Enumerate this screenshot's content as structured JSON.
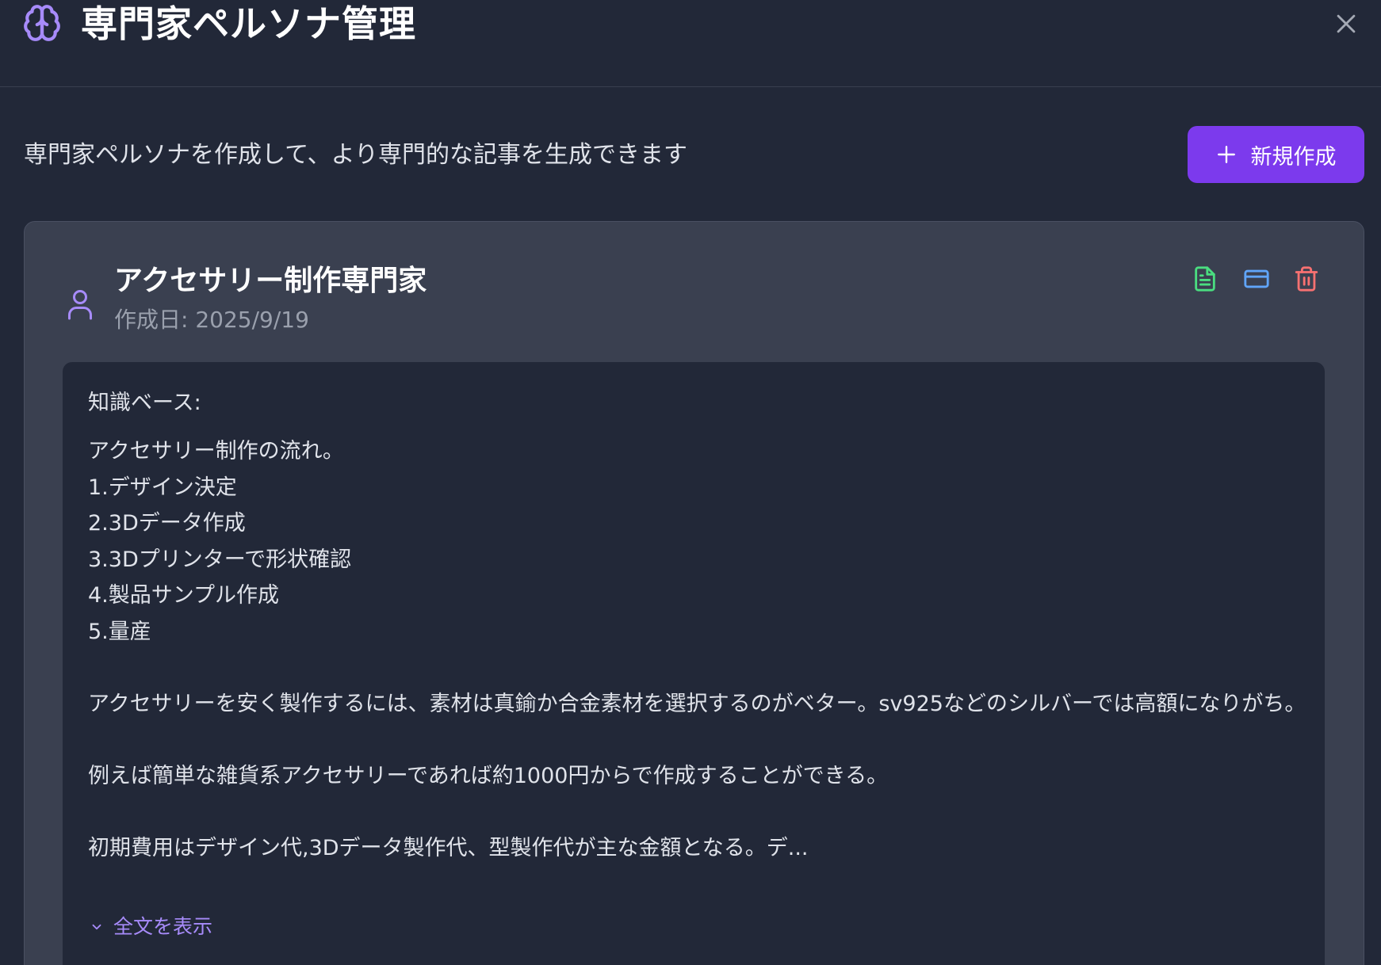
{
  "header": {
    "title": "専門家ペルソナ管理",
    "icon": "brain-icon",
    "close_icon": "close-icon"
  },
  "toolbar": {
    "description": "専門家ペルソナを作成して、より専門的な記事を生成できます",
    "new_button_label": "新規作成",
    "new_button_icon": "plus-icon"
  },
  "persona": {
    "name": "アクセサリー制作専門家",
    "created": "作成日: 2025/9/19",
    "icon": "person-icon",
    "actions": [
      "document-icon",
      "card-icon",
      "trash-icon"
    ],
    "knowledge_label": "知識ベース:",
    "knowledge_text": "アクセサリー制作の流れ。\n1.デザイン決定\n2.3Dデータ作成\n3.3Dプリンターで形状確認\n4.製品サンプル作成\n5.量産\n\nアクセサリーを安く製作するには、素材は真鍮か合金素材を選択するのがベター。sv925などのシルバーでは高額になりがち。\n\n例えば簡単な雑貨系アクセサリーであれば約1000円からで作成することができる。\n\n初期費用はデザイン代,3Dデータ製作代、型製作代が主な金額となる。デ...",
    "expand_label": "全文を表示"
  },
  "colors": {
    "background": "#222838",
    "card": "#3a4050",
    "accent": "#7c3aed",
    "link": "#a78bfa",
    "doc_icon": "#4ade80",
    "card_icon": "#60a5fa",
    "trash_icon": "#f87171"
  }
}
